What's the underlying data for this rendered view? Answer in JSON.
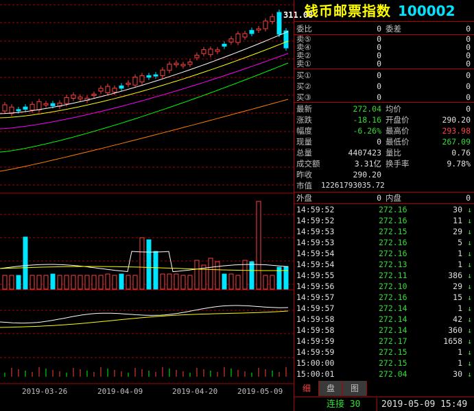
{
  "title": {
    "name": "钱币邮票指数",
    "code": "100002"
  },
  "chart_price_label": "311.08",
  "x_axis_dates": [
    "2019-03-26",
    "2019-04-09",
    "2019-04-20",
    "2019-05-09"
  ],
  "order_book": {
    "weibi_label": "委比",
    "weibi": "0",
    "weicha_label": "委差",
    "weicha": "0",
    "sells": [
      {
        "label": "卖⑤",
        "price": "0",
        "vol": "0"
      },
      {
        "label": "卖④",
        "price": "0",
        "vol": "0"
      },
      {
        "label": "卖②",
        "price": "0",
        "vol": "0"
      },
      {
        "label": "卖①",
        "price": "0",
        "vol": "0"
      }
    ],
    "buys": [
      {
        "label": "买①",
        "price": "0",
        "vol": "0"
      },
      {
        "label": "买②",
        "price": "0",
        "vol": "0"
      },
      {
        "label": "买③",
        "price": "0",
        "vol": "0"
      }
    ]
  },
  "quote": {
    "latest_label": "最新",
    "latest": "272.04",
    "avg_label": "均价",
    "avg": "0",
    "change_label": "涨跌",
    "change": "-18.16",
    "open_label": "开盘价",
    "open": "290.20",
    "pct_label": "幅度",
    "pct": "-6.26%",
    "high_label": "最高价",
    "high": "293.98",
    "vol_label": "现量",
    "vol": "0",
    "low_label": "最低价",
    "low": "267.09",
    "total_label": "总量",
    "total": "4407423",
    "ratio_label": "量比",
    "ratio": "0.76",
    "amount_label": "成交额",
    "amount": "3.31亿",
    "turnover_label": "换手率",
    "turnover": "9.78%",
    "prev_label": "昨收",
    "prev": "290.20",
    "mcap_label": "市值",
    "mcap": "12261793035.72",
    "outer_label": "外盘",
    "outer": "0",
    "inner_label": "内盘",
    "inner": "0"
  },
  "ticks": [
    {
      "time": "14:59:52",
      "price": "272.16",
      "vol": "30",
      "dir": "↓"
    },
    {
      "time": "14:59:52",
      "price": "272.16",
      "vol": "11",
      "dir": "↓"
    },
    {
      "time": "14:59:53",
      "price": "272.15",
      "vol": "29",
      "dir": "↓"
    },
    {
      "time": "14:59:53",
      "price": "272.16",
      "vol": "5",
      "dir": "↓"
    },
    {
      "time": "14:59:54",
      "price": "272.16",
      "vol": "1",
      "dir": "↓"
    },
    {
      "time": "14:59:54",
      "price": "272.13",
      "vol": "1",
      "dir": "↓"
    },
    {
      "time": "14:59:55",
      "price": "272.11",
      "vol": "386",
      "dir": "↓"
    },
    {
      "time": "14:59:56",
      "price": "272.10",
      "vol": "29",
      "dir": "↓"
    },
    {
      "time": "14:59:57",
      "price": "272.16",
      "vol": "15",
      "dir": "↓"
    },
    {
      "time": "14:59:57",
      "price": "272.14",
      "vol": "1",
      "dir": "↓"
    },
    {
      "time": "14:59:58",
      "price": "272.14",
      "vol": "42",
      "dir": "↓"
    },
    {
      "time": "14:59:58",
      "price": "272.14",
      "vol": "360",
      "dir": "↓"
    },
    {
      "time": "14:59:59",
      "price": "272.17",
      "vol": "1658",
      "dir": "↓"
    },
    {
      "time": "14:59:59",
      "price": "272.15",
      "vol": "1",
      "dir": "↓"
    },
    {
      "time": "15:00:00",
      "price": "272.15",
      "vol": "1",
      "dir": "↓"
    },
    {
      "time": "15:00:01",
      "price": "272.04",
      "vol": "30",
      "dir": "↓"
    }
  ],
  "tabs": [
    "细",
    "盘",
    "图"
  ],
  "status": {
    "conn_label": "连接",
    "conn_value": "30",
    "datetime": "2019-05-09 15:49"
  },
  "colors": {
    "up": "#ff4040",
    "down": "#00e5ff",
    "ma5": "#ffffff",
    "ma10": "#ffff00",
    "ma20": "#ff00ff",
    "ma30": "#00ff00",
    "ma60": "#ff8000",
    "grid": "#b00000"
  }
}
